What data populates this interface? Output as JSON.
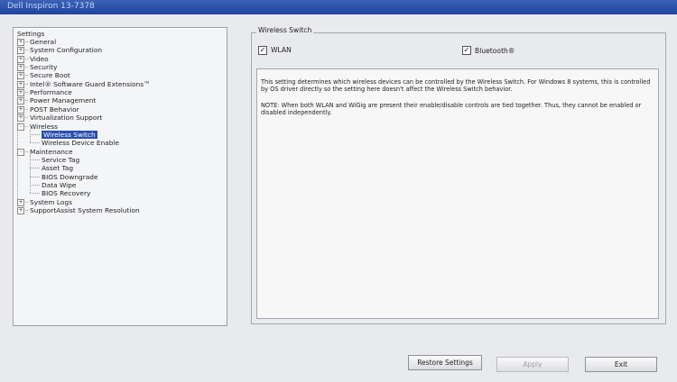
{
  "window": {
    "title": "Dell Inspiron 13-7378"
  },
  "tree": {
    "root": "Settings",
    "items": [
      {
        "label": "General",
        "level": 1,
        "expander": "+"
      },
      {
        "label": "System Configuration",
        "level": 1,
        "expander": "+"
      },
      {
        "label": "Video",
        "level": 1,
        "expander": "+"
      },
      {
        "label": "Security",
        "level": 1,
        "expander": "+"
      },
      {
        "label": "Secure Boot",
        "level": 1,
        "expander": "+"
      },
      {
        "label": "Intel® Software Guard Extensions™",
        "level": 1,
        "expander": "+"
      },
      {
        "label": "Performance",
        "level": 1,
        "expander": "+"
      },
      {
        "label": "Power Management",
        "level": 1,
        "expander": "+"
      },
      {
        "label": "POST Behavior",
        "level": 1,
        "expander": "+"
      },
      {
        "label": "Virtualization Support",
        "level": 1,
        "expander": "+"
      },
      {
        "label": "Wireless",
        "level": 1,
        "expander": "-"
      },
      {
        "label": "Wireless Switch",
        "level": 2,
        "selected": true
      },
      {
        "label": "Wireless Device Enable",
        "level": 2
      },
      {
        "label": "Maintenance",
        "level": 1,
        "expander": "-"
      },
      {
        "label": "Service Tag",
        "level": 2
      },
      {
        "label": "Asset Tag",
        "level": 2
      },
      {
        "label": "BIOS Downgrade",
        "level": 2
      },
      {
        "label": "Data Wipe",
        "level": 2
      },
      {
        "label": "BIOS Recovery",
        "level": 2
      },
      {
        "label": "System Logs",
        "level": 1,
        "expander": "+"
      },
      {
        "label": "SupportAssist System Resolution",
        "level": 1,
        "expander": "+"
      }
    ]
  },
  "panel": {
    "group_title": "Wireless Switch",
    "wlan_label": "WLAN",
    "wlan_checked": "✓",
    "bt_label": "Bluetooth®",
    "bt_checked": "✓",
    "desc_1": "This setting determines which wireless devices can be controlled by the Wireless Switch. For Windows 8 systems, this is controlled by OS driver directly so the setting here doesn't affect the Wireless Switch behavior.",
    "desc_2": "NOTE: When both WLAN and WiGig are present their enable/disable controls are tied together.  Thus, they cannot be enabled or disabled independently."
  },
  "buttons": {
    "restore": "Restore Settings",
    "apply": "Apply",
    "exit": "Exit"
  }
}
